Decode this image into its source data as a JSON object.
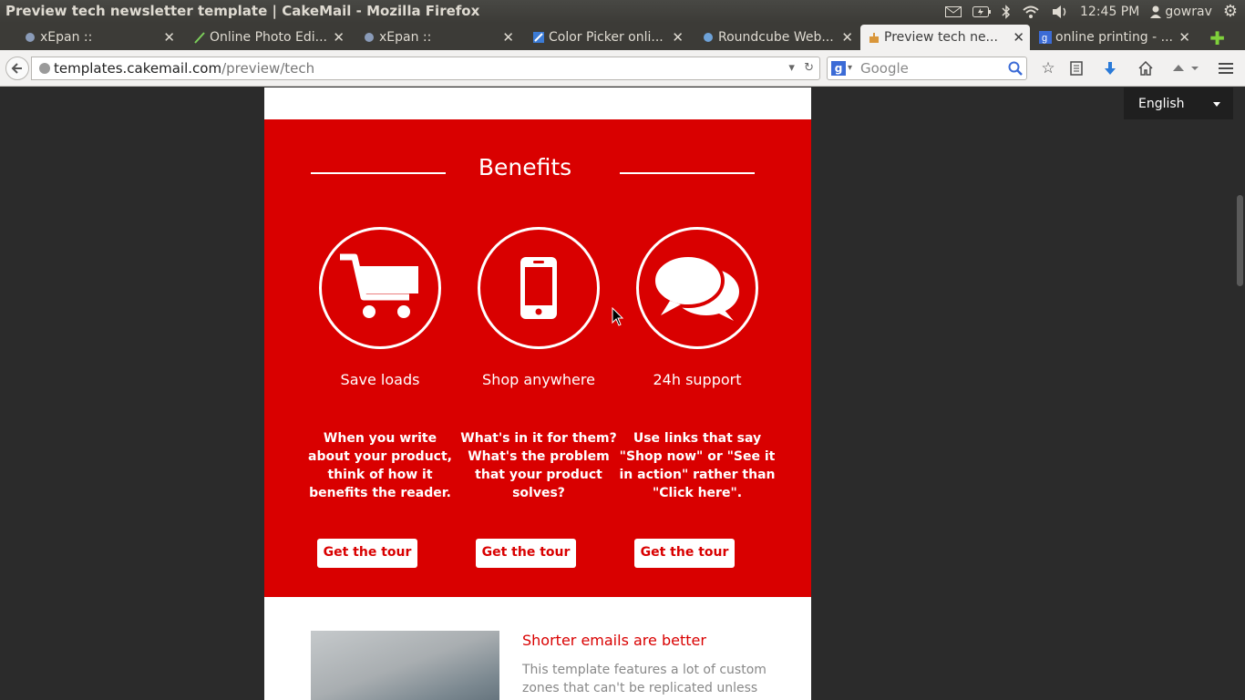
{
  "window": {
    "title": "Preview tech newsletter template | CakeMail - Mozilla Firefox"
  },
  "tray": {
    "time": "12:45 PM",
    "user": "gowrav"
  },
  "tabs": [
    {
      "label": "xEpan ::",
      "active": false
    },
    {
      "label": "Online Photo Edi...",
      "active": false
    },
    {
      "label": "xEpan ::",
      "active": false
    },
    {
      "label": "Color Picker onli...",
      "active": false
    },
    {
      "label": "Roundcube Web...",
      "active": false
    },
    {
      "label": "Preview tech ne...",
      "active": true
    },
    {
      "label": "online printing - ...",
      "active": false
    }
  ],
  "navbar": {
    "url_domain": "templates.cakemail.com",
    "url_path": "/preview/tech",
    "search_placeholder": "Google"
  },
  "page": {
    "language": "English",
    "benefits_title": "Benefits",
    "features": [
      {
        "icon": "cart-icon",
        "title": "Save loads",
        "desc": "When you write about your product, think of how it benefits the reader.",
        "button": "Get the tour"
      },
      {
        "icon": "phone-icon",
        "title": "Shop anywhere",
        "desc": "What's in it for them? What's the problem that your product solves?",
        "button": "Get the tour"
      },
      {
        "icon": "chat-icon",
        "title": "24h support",
        "desc": "Use links that say \"Shop now\" or \"See it in action\" rather than \"Click here\".",
        "button": "Get the tour"
      }
    ],
    "article": {
      "title": "Shorter emails are better",
      "body": "This template features a lot of custom zones that can't be replicated unless you"
    }
  },
  "colors": {
    "accent": "#d90000",
    "page_bg": "#2b2b2b"
  }
}
